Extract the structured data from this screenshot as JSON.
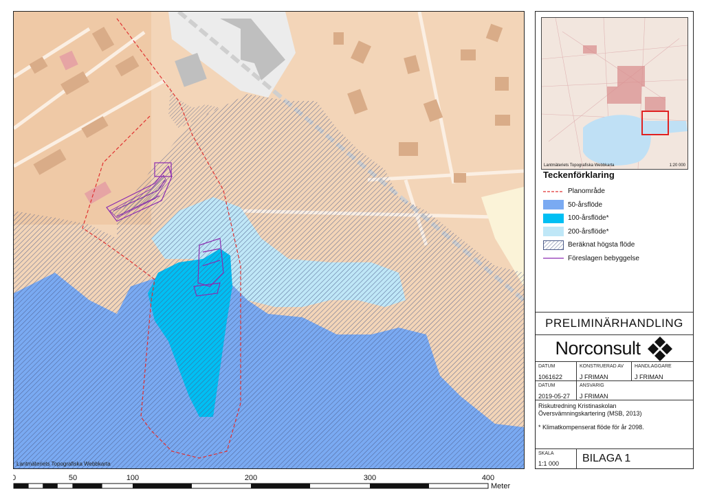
{
  "map": {
    "credit": "Lantmäteriets Topografiska Webbkarta",
    "colors": {
      "land": "#f3d5b8",
      "residential": "#efc9a6",
      "building": "#d9ac88",
      "road": "#fbefe3",
      "flood_50": "#7aaaf2",
      "flood_100": "#00bff3",
      "flood_200": "#bfe7f7",
      "hatch": "#4a5a88",
      "plan_area": "#e03030",
      "proposed": "#8a2bb0"
    }
  },
  "scalebar": {
    "ticks": [
      "0",
      "50",
      "100",
      "200",
      "300",
      "400"
    ],
    "unit": "Meter"
  },
  "overview": {
    "credit": "Lantmäteriets Topografiska Webbkarta",
    "scale": "1:20 000"
  },
  "legend": {
    "title": "Teckenförklaring",
    "items": [
      {
        "label": "Planområde",
        "symbol": "dashed-red-line"
      },
      {
        "label": "50-årsflöde",
        "symbol": "fill-50"
      },
      {
        "label": "100-årsflöde*",
        "symbol": "fill-100"
      },
      {
        "label": "200-årsflöde*",
        "symbol": "fill-200"
      },
      {
        "label": "Beräknat högsta flöde",
        "symbol": "hatch"
      },
      {
        "label": "Föreslagen bebyggelse",
        "symbol": "purple-line"
      }
    ]
  },
  "title_block": {
    "status": "PRELIMINÄRHANDLING",
    "company": "Norconsult",
    "datum_label": "DATUM",
    "datum_value": "1061622",
    "konstruerad_label": "KONSTRUERAD AV",
    "konstruerad_value": "J FRIMAN",
    "handlaggare_label": "HANDLAGGARE",
    "handlaggare_value": "J FRIMAN",
    "datum2_label": "DATUM",
    "datum2_value": "2019-05-27",
    "ansvarig_label": "ANSVARIG",
    "ansvarig_value": "J FRIMAN",
    "desc_line1": "Riskutredning Kristinaskolan",
    "desc_line2": "Översvämningskartering (MSB, 2013)",
    "note": "* Klimatkompenserat flöde för år 2098.",
    "skala_label": "SKALA",
    "skala_value": "1:1 000",
    "sheet": "BILAGA 1"
  }
}
